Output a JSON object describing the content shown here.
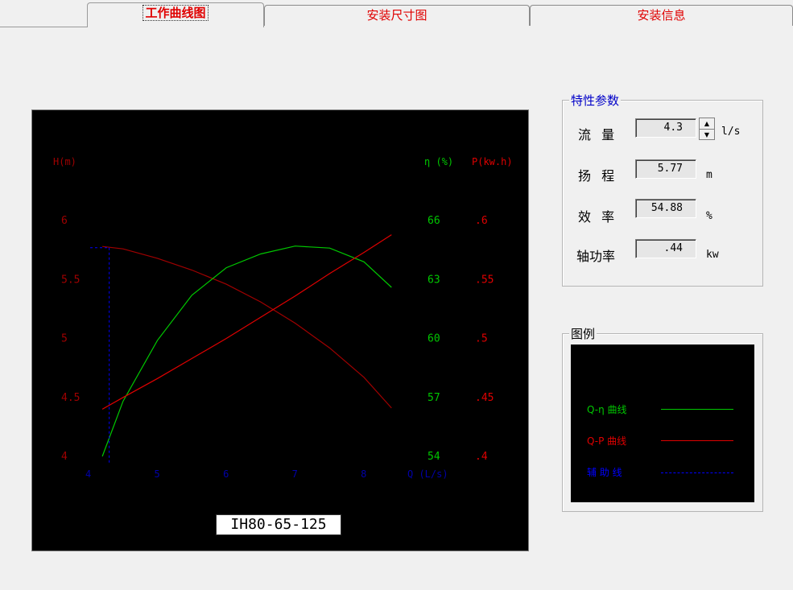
{
  "tabs": [
    {
      "label": "工作曲线图",
      "active": true
    },
    {
      "label": "安装尺寸图",
      "active": false
    },
    {
      "label": "安装信息",
      "active": false
    }
  ],
  "params": {
    "title": "特性参数",
    "flow": {
      "label": "流 量",
      "value": "4.3",
      "unit": "l/s"
    },
    "head": {
      "label": "扬 程",
      "value": "5.77",
      "unit": "m"
    },
    "efficiency": {
      "label": "效 率",
      "value": "54.88",
      "unit": "%"
    },
    "shaft_power": {
      "label": "轴功率",
      "value": ".44",
      "unit": "kw"
    }
  },
  "legend": {
    "title": "图例",
    "items": [
      {
        "label": "Q-η 曲线",
        "color": "#00c800"
      },
      {
        "label": "Q-P 曲线",
        "color": "#e00000"
      },
      {
        "label": "辅 助 线",
        "color": "#0000ff"
      }
    ]
  },
  "model": "IH80-65-125",
  "colors": {
    "head": "#a00000",
    "efficiency": "#00c800",
    "power": "#e00000",
    "aux": "#0000ff",
    "axis_x": "#0000aa"
  },
  "chart_data": {
    "type": "line",
    "title": "",
    "xlabel": "Q (L/s)",
    "x_ticks": [
      "4",
      "5",
      "6",
      "7",
      "8"
    ],
    "xlim": [
      4,
      8.7
    ],
    "y_axes": [
      {
        "name": "H",
        "label": "H(m)",
        "ticks": [
          "6",
          "5.5",
          "5",
          "4.5",
          "4"
        ],
        "ylim": [
          4,
          6
        ]
      },
      {
        "name": "eta",
        "label": "η (%)",
        "ticks": [
          "66",
          "63",
          "60",
          "57",
          "54"
        ],
        "ylim": [
          54,
          66
        ]
      },
      {
        "name": "P",
        "label": "P(kw.h)",
        "ticks": [
          ".6",
          ".55",
          ".5",
          ".45",
          ".4"
        ],
        "ylim": [
          0.4,
          0.6
        ]
      }
    ],
    "series": [
      {
        "name": "Q-H",
        "axis": "H",
        "x": [
          4.2,
          4.5,
          5.0,
          5.5,
          6.0,
          6.5,
          7.0,
          7.5,
          8.0,
          8.4
        ],
        "y": [
          5.78,
          5.76,
          5.68,
          5.58,
          5.46,
          5.31,
          5.13,
          4.92,
          4.67,
          4.41
        ]
      },
      {
        "name": "Q-η",
        "axis": "eta",
        "x": [
          4.2,
          4.5,
          5.0,
          5.5,
          6.0,
          6.5,
          7.0,
          7.5,
          8.0,
          8.4
        ],
        "y": [
          54.0,
          56.8,
          59.9,
          62.2,
          63.6,
          64.3,
          64.7,
          64.6,
          63.9,
          62.6
        ]
      },
      {
        "name": "Q-P",
        "axis": "P",
        "x": [
          4.2,
          4.5,
          5.0,
          5.5,
          6.0,
          6.5,
          7.0,
          7.5,
          8.0,
          8.4
        ],
        "y": [
          0.44,
          0.45,
          0.466,
          0.483,
          0.5,
          0.518,
          0.536,
          0.555,
          0.573,
          0.588
        ]
      }
    ],
    "aux_point": {
      "q": 4.3,
      "h": 5.77
    }
  }
}
